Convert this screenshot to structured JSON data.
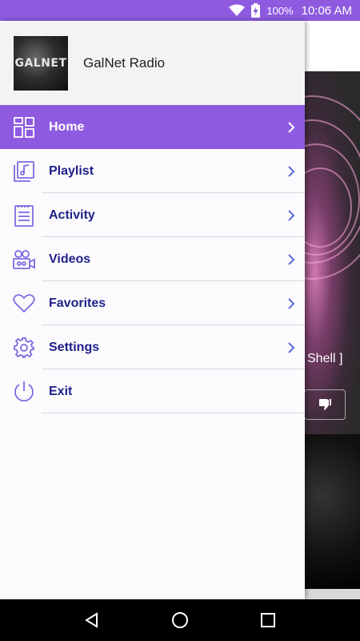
{
  "status_bar": {
    "battery": "100%",
    "time": "10:06 AM",
    "icons": [
      "wifi-icon",
      "battery-charging-icon"
    ]
  },
  "background": {
    "now_playing_fragment": "Shell ]"
  },
  "drawer": {
    "app_title": "GalNet Radio",
    "logo_text": "GALNET",
    "items": [
      {
        "label": "Home",
        "icon": "home-grid-icon",
        "active": true
      },
      {
        "label": "Playlist",
        "icon": "playlist-icon",
        "active": false
      },
      {
        "label": "Activity",
        "icon": "activity-list-icon",
        "active": false
      },
      {
        "label": "Videos",
        "icon": "video-camera-icon",
        "active": false
      },
      {
        "label": "Favorites",
        "icon": "heart-icon",
        "active": false
      },
      {
        "label": "Settings",
        "icon": "gear-icon",
        "active": false
      },
      {
        "label": "Exit",
        "icon": "power-icon",
        "active": false
      }
    ]
  },
  "colors": {
    "accent": "#8e5ae0",
    "menu_text": "#1f1f8a",
    "icon": "#7b6be0"
  },
  "nav_bar": [
    "back-icon",
    "home-circle-icon",
    "recents-icon"
  ]
}
